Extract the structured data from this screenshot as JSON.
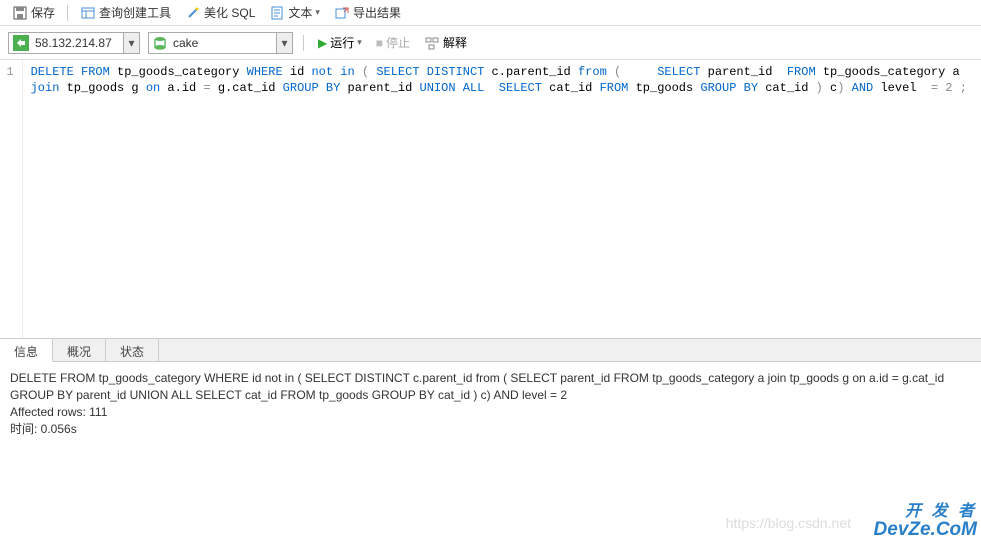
{
  "toolbar": {
    "save": "保存",
    "query_builder": "查询创建工具",
    "beautify": "美化 SQL",
    "text": "文本",
    "export": "导出结果"
  },
  "connection": {
    "host": "58.132.214.87",
    "database": "cake"
  },
  "actions": {
    "run": "运行",
    "stop": "停止",
    "explain": "解释"
  },
  "editor": {
    "line_number": "1",
    "sql_tokens": [
      {
        "t": "DELETE",
        "c": "kw"
      },
      {
        "t": " "
      },
      {
        "t": "FROM",
        "c": "kw"
      },
      {
        "t": " tp_goods_category "
      },
      {
        "t": "WHERE",
        "c": "kw"
      },
      {
        "t": " id "
      },
      {
        "t": "not",
        "c": "kw"
      },
      {
        "t": " "
      },
      {
        "t": "in",
        "c": "kw"
      },
      {
        "t": " "
      },
      {
        "t": "(",
        "c": "gray"
      },
      {
        "t": " "
      },
      {
        "t": "SELECT",
        "c": "kw"
      },
      {
        "t": " "
      },
      {
        "t": "DISTINCT",
        "c": "kw"
      },
      {
        "t": " c.parent_id "
      },
      {
        "t": "from",
        "c": "kw"
      },
      {
        "t": " "
      },
      {
        "t": "(",
        "c": "gray"
      },
      {
        "t": "     "
      },
      {
        "t": "SELECT",
        "c": "kw"
      },
      {
        "t": " parent_id  "
      },
      {
        "t": "FROM",
        "c": "kw"
      },
      {
        "t": " tp_goods_category a "
      },
      {
        "t": "join",
        "c": "kw"
      },
      {
        "t": " tp_goods g "
      },
      {
        "t": "on",
        "c": "kw"
      },
      {
        "t": " a.id "
      },
      {
        "t": "=",
        "c": "gray"
      },
      {
        "t": " g.cat_id "
      },
      {
        "t": "GROUP",
        "c": "kw"
      },
      {
        "t": " "
      },
      {
        "t": "BY",
        "c": "kw"
      },
      {
        "t": " parent_id "
      },
      {
        "t": "UNION",
        "c": "kw"
      },
      {
        "t": " "
      },
      {
        "t": "ALL",
        "c": "kw"
      },
      {
        "t": "  "
      },
      {
        "t": "SELECT",
        "c": "kw"
      },
      {
        "t": " cat_id "
      },
      {
        "t": "FROM",
        "c": "kw"
      },
      {
        "t": " tp_goods "
      },
      {
        "t": "GROUP",
        "c": "kw"
      },
      {
        "t": " "
      },
      {
        "t": "BY",
        "c": "kw"
      },
      {
        "t": " cat_id "
      },
      {
        "t": ")",
        "c": "gray"
      },
      {
        "t": " c"
      },
      {
        "t": ")",
        "c": "gray"
      },
      {
        "t": " "
      },
      {
        "t": "AND",
        "c": "kw"
      },
      {
        "t": " level  "
      },
      {
        "t": "=",
        "c": "gray"
      },
      {
        "t": " "
      },
      {
        "t": "2",
        "c": "gray"
      },
      {
        "t": " "
      },
      {
        "t": ";",
        "c": "gray"
      }
    ]
  },
  "tabs": {
    "info": "信息",
    "profile": "概况",
    "status": "状态"
  },
  "output": {
    "line1": "DELETE FROM tp_goods_category WHERE id not in ( SELECT DISTINCT c.parent_id from (     SELECT parent_id  FROM tp_goods_category a join tp_goods g on a.id = g.cat_id GROUP BY parent_id UNION ALL  SELECT cat_id FROM tp_goods GROUP BY cat_id ) c) AND level  = 2",
    "line2": "Affected rows: 111",
    "line3": "时间: 0.056s"
  },
  "watermark": {
    "url": "https://blog.csdn.net",
    "brand_top": "开 发 者",
    "brand_bottom": "DevZe.CoM"
  }
}
